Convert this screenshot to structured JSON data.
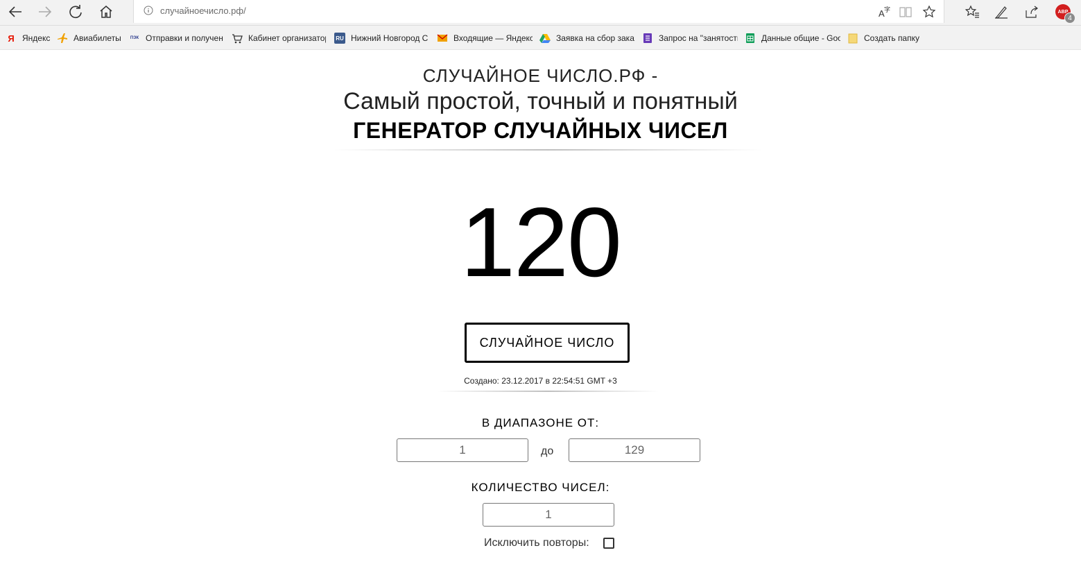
{
  "browser": {
    "url": "случайноечисло.рф/",
    "abp_label": "ABP",
    "abp_count": "4"
  },
  "favorites": [
    {
      "label": "Яндекс",
      "icon": "yandex-icon",
      "color": "#e61400"
    },
    {
      "label": "Авиабилеты",
      "icon": "plane-icon",
      "color": "#f0a000"
    },
    {
      "label": "Отправки и получен",
      "icon": "pecom-icon",
      "color": "#2a3a8c"
    },
    {
      "label": "Кабинет организатор",
      "icon": "cart-icon",
      "color": "#333333"
    },
    {
      "label": "Нижний Новгород С",
      "icon": "ru-icon",
      "color": "#3b5a8c"
    },
    {
      "label": "Входящие — Яндекс",
      "icon": "mail-icon",
      "color": "#f0a000"
    },
    {
      "label": "Заявка на сбор зака:",
      "icon": "drive-icon",
      "color": "#1fa463"
    },
    {
      "label": "Запрос на \"занятости",
      "icon": "forms-icon",
      "color": "#673ab7"
    },
    {
      "label": "Данные общие - Goo",
      "icon": "sheets-icon",
      "color": "#0f9d58"
    },
    {
      "label": "Создать папку",
      "icon": "folder-icon",
      "color": "#f5c242"
    }
  ],
  "header": {
    "line1": "СЛУЧАЙНОЕ ЧИСЛО.РФ -",
    "line2": "Самый простой, точный и понятный",
    "line3": "ГЕНЕРАТОР СЛУЧАЙНЫХ ЧИСЕЛ"
  },
  "result": {
    "number": "120",
    "button_label": "СЛУЧАЙНОЕ ЧИСЛО",
    "created": "Создано: 23.12.2017 в 22:54:51 GMT +3"
  },
  "range": {
    "label": "В ДИАПАЗОНЕ ОТ:",
    "from": "1",
    "separator": "до",
    "to": "129"
  },
  "count": {
    "label": "КОЛИЧЕСТВО ЧИСЕЛ:",
    "value": "1"
  },
  "exclude": {
    "label": "Исключить повторы:",
    "checked": false
  }
}
